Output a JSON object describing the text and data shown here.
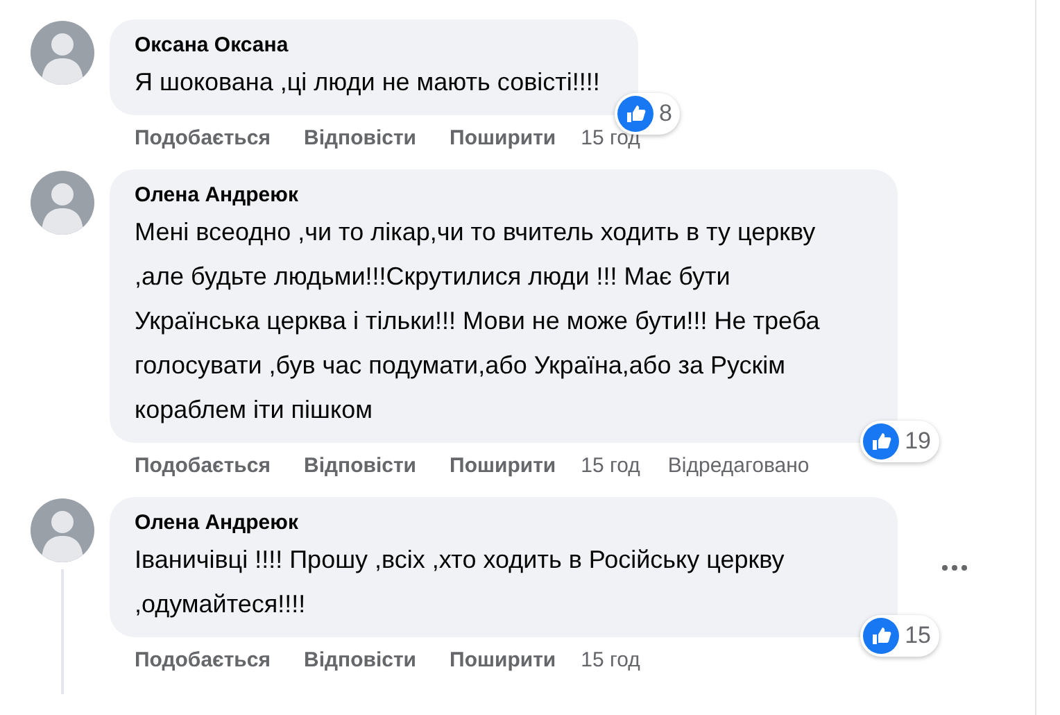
{
  "comments": [
    {
      "author": "Оксана Оксана",
      "text": "Я шокована ,ці люди не мають совісті!!!!",
      "reactions": "8",
      "actions": [
        "Подобається",
        "Відповісти",
        "Поширити"
      ],
      "time": "15 год",
      "menu": false,
      "thread": false
    },
    {
      "author": "Олена Андреюк",
      "text": "Мені всеодно ,чи то лікар,чи то вчитель ходить в ту церкву ,але будьте людьми!!!Скрутилися люди !!! Має бути Українська церква і тільки!!! Мови не може бути!!! Не треба голосувати ,був час подумати,або Україна,або за Рускім кораблем іти пішком",
      "reactions": "19",
      "actions": [
        "Подобається",
        "Відповісти",
        "Поширити"
      ],
      "time": "15 год",
      "edited": "Відредаговано",
      "menu": false,
      "thread": false
    },
    {
      "author": "Олена Андреюк",
      "text": "Іваничівці !!!! Прошу ,всіх ,хто ходить в Російську церкву ,одумайтеся!!!!",
      "reactions": "15",
      "actions": [
        "Подобається",
        "Відповісти",
        "Поширити"
      ],
      "time": "15 год",
      "menu": true,
      "thread": true
    }
  ]
}
